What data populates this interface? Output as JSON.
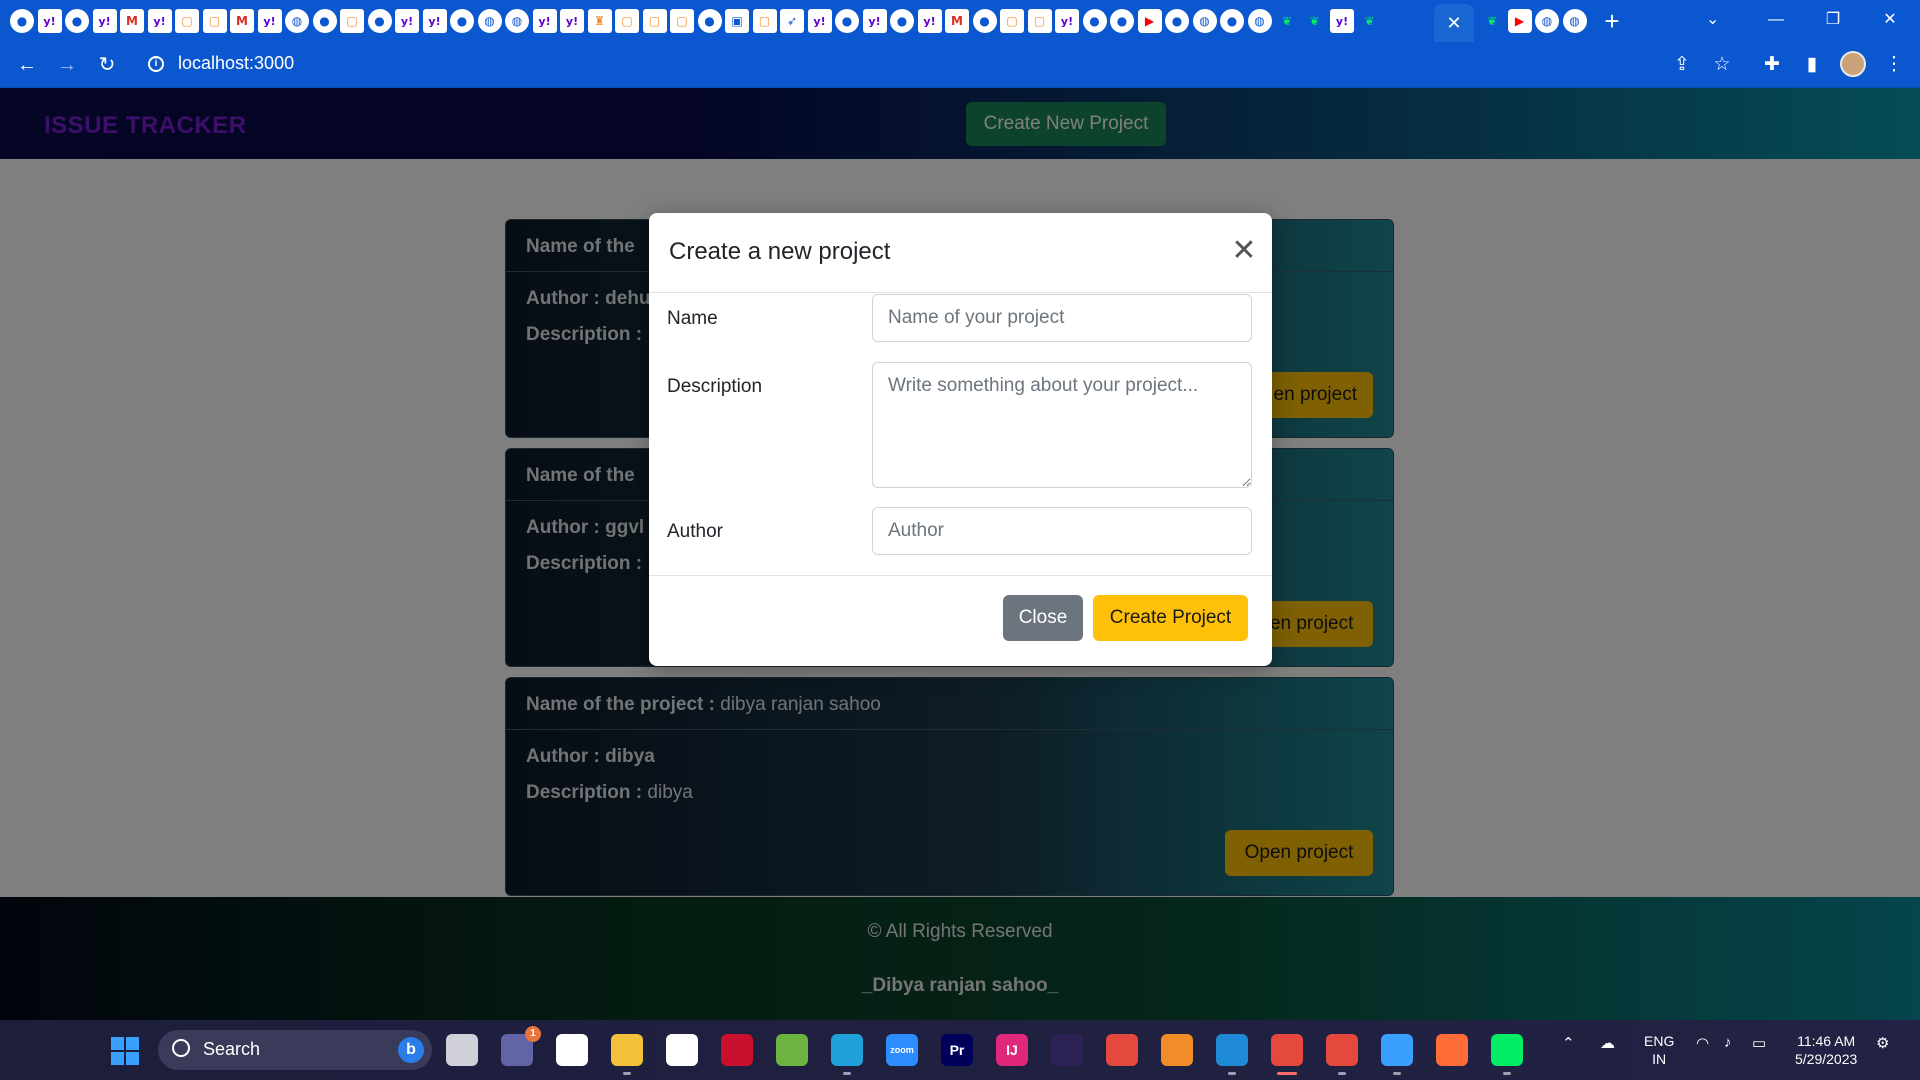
{
  "browser": {
    "tab_icons": [
      "github",
      "yahoo",
      "github",
      "yahoo",
      "gmail",
      "yahoo",
      "code",
      "code",
      "gmail",
      "yahoo",
      "globe",
      "github",
      "code",
      "github",
      "yahoo",
      "yahoo",
      "github",
      "globe",
      "globe",
      "yahoo",
      "yahoo",
      "award",
      "code",
      "code",
      "code",
      "github",
      "app",
      "code",
      "cursor",
      "yahoo",
      "github",
      "yahoo",
      "github",
      "yahoo",
      "gmail",
      "github",
      "code",
      "code",
      "yahoo",
      "github",
      "github",
      "youtube",
      "github",
      "globe",
      "github",
      "globe",
      "mongodb",
      "mongodb",
      "yahoo",
      "mongodb"
    ],
    "trailing_tab_icons": [
      "mongodb",
      "youtube",
      "globe",
      "globe"
    ],
    "active_tab_close": "✕",
    "new_tab": "+",
    "url": "localhost:3000",
    "window_controls": {
      "minimize": "—",
      "maximize": "❐",
      "close": "✕"
    }
  },
  "app": {
    "brand": "ISSUE TRACKER",
    "create_button": "Create New Project",
    "projects": [
      {
        "name_label": "Name of the",
        "name": "",
        "author_label": "Author : ",
        "author": "dehu",
        "description_label": "Description :",
        "description": "",
        "open_label": "en project"
      },
      {
        "name_label": "Name of the",
        "name": "",
        "author_label": "Author : ",
        "author": "ggvl",
        "description_label": "Description :",
        "description": "",
        "open_label": "Open project"
      },
      {
        "name_label": "Name of the project :",
        "name": "dibya ranjan sahoo",
        "author_label": "Author : ",
        "author": "dibya",
        "description_label": "Description :",
        "description": "dibya",
        "open_label": "Open project"
      }
    ],
    "footer": {
      "rights": "© All Rights Reserved",
      "author": "_Dibya ranjan sahoo_"
    }
  },
  "modal": {
    "title": "Create a new project",
    "close_icon": "✕",
    "fields": {
      "name_label": "Name",
      "name_placeholder": "Name of your project",
      "description_label": "Description",
      "description_placeholder": "Write something about your project...",
      "author_label": "Author",
      "author_placeholder": "Author"
    },
    "close_button": "Close",
    "submit_button": "Create Project"
  },
  "taskbar": {
    "search_label": "Search",
    "apps": [
      {
        "name": "task-view",
        "label": "",
        "color": "#d0d0d8"
      },
      {
        "name": "teams",
        "label": "",
        "color": "#6264a7",
        "badge": "1"
      },
      {
        "name": "slack",
        "label": "",
        "color": "#ffffff"
      },
      {
        "name": "file-explorer",
        "label": "",
        "color": "#f3c13a"
      },
      {
        "name": "store",
        "label": "",
        "color": "#ffffff"
      },
      {
        "name": "mcafee",
        "label": "",
        "color": "#c8102e"
      },
      {
        "name": "spring-tool",
        "label": "",
        "color": "#6db33f"
      },
      {
        "name": "edge",
        "label": "",
        "color": "#1fa0d8"
      },
      {
        "name": "zoom",
        "label": "zoom",
        "color": "#2d8cff"
      },
      {
        "name": "premiere",
        "label": "Pr",
        "color": "#00005b"
      },
      {
        "name": "intellij",
        "label": "IJ",
        "color": "#e0287a"
      },
      {
        "name": "eclipse",
        "label": "",
        "color": "#2c2255"
      },
      {
        "name": "chrome",
        "label": "",
        "color": "#e5483c"
      },
      {
        "name": "sublime",
        "label": "",
        "color": "#f28c28"
      },
      {
        "name": "vscode",
        "label": "",
        "color": "#1e8ad6"
      },
      {
        "name": "chrome-active",
        "label": "",
        "color": "#e5483c"
      },
      {
        "name": "chrome-dev",
        "label": "",
        "color": "#e5483c"
      },
      {
        "name": "paint",
        "label": "",
        "color": "#3aa0ff"
      },
      {
        "name": "postman",
        "label": "",
        "color": "#ff6c37"
      },
      {
        "name": "mongodb-compass",
        "label": "",
        "color": "#00ed64"
      }
    ],
    "language": "ENG",
    "region": "IN",
    "time": "11:46 AM",
    "date": "5/29/2023"
  }
}
